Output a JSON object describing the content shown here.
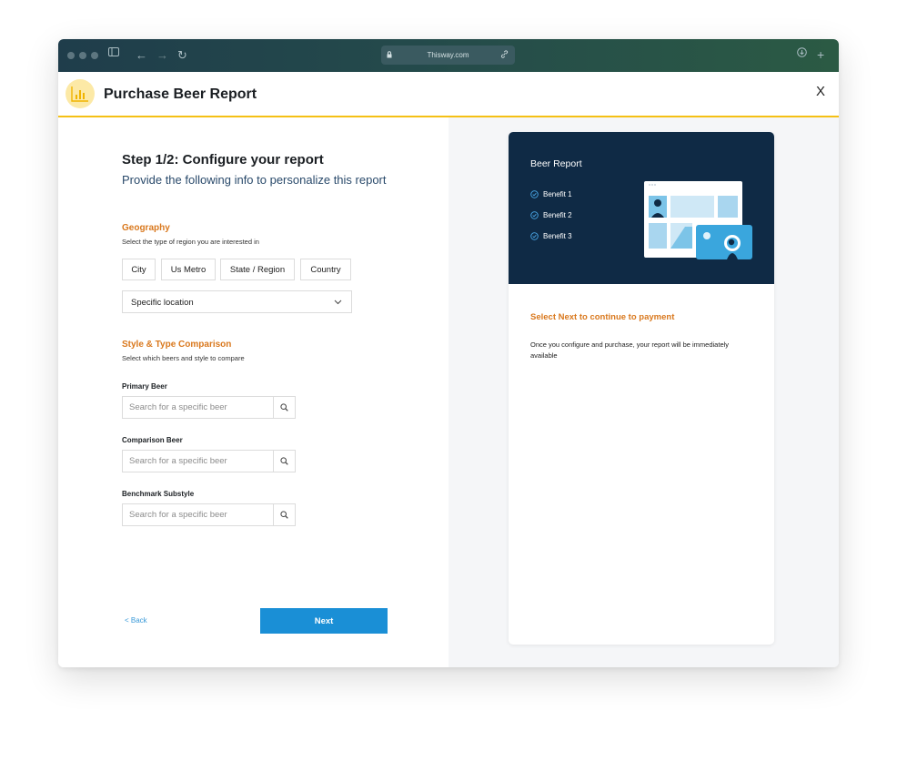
{
  "browser": {
    "url": "Thisway.com"
  },
  "modal": {
    "title": "Purchase Beer Report",
    "close_label": "X"
  },
  "form": {
    "step_title": "Step 1/2: Configure your report",
    "step_subtitle": "Provide the following info to personalize this report",
    "geography": {
      "title": "Geography",
      "subtitle": "Select the type of region you are interested in",
      "options": [
        "City",
        "Us Metro",
        "State / Region",
        "Country"
      ],
      "location_select": "Specific location"
    },
    "comparison": {
      "title": "Style & Type Comparison",
      "subtitle": "Select which beers and style to compare",
      "fields": [
        {
          "label": "Primary Beer",
          "placeholder": "Search for a specific beer"
        },
        {
          "label": "Comparison Beer",
          "placeholder": "Search for a specific beer"
        },
        {
          "label": "Benchmark Substyle",
          "placeholder": "Search for a specific beer"
        }
      ]
    },
    "back_label": "< Back",
    "next_label": "Next"
  },
  "summary": {
    "title": "Beer Report",
    "benefits": [
      "Benefit 1",
      "Benefit 2",
      "Benefit 3"
    ],
    "cta": "Select Next to continue to payment",
    "description": "Once you configure and purchase, your report will be immediately available"
  },
  "colors": {
    "accent_yellow": "#f5c015",
    "accent_orange": "#d9781d",
    "primary_blue": "#1a8fd6",
    "banner_navy": "#0f2a45"
  }
}
